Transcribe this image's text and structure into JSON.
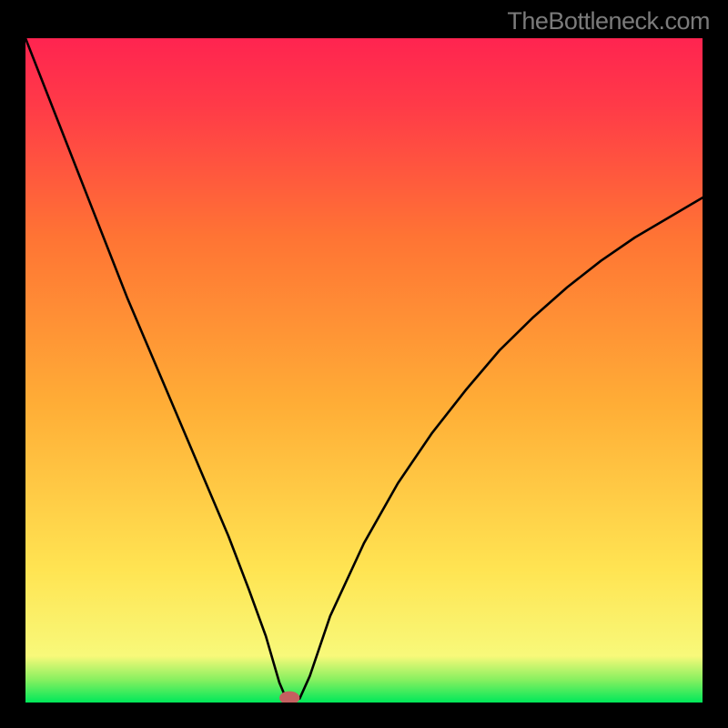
{
  "watermark": "TheBottleneck.com",
  "chart_data": {
    "type": "line",
    "title": "",
    "xlabel": "",
    "ylabel": "",
    "xlim": [
      0,
      100
    ],
    "ylim": [
      0,
      100
    ],
    "background_gradient": {
      "stops": [
        {
          "pos": 0.0,
          "color": "#00e85a"
        },
        {
          "pos": 0.035,
          "color": "#8af060"
        },
        {
          "pos": 0.07,
          "color": "#f8f97a"
        },
        {
          "pos": 0.2,
          "color": "#ffe452"
        },
        {
          "pos": 0.45,
          "color": "#ffad36"
        },
        {
          "pos": 0.7,
          "color": "#ff7434"
        },
        {
          "pos": 0.9,
          "color": "#ff3a48"
        },
        {
          "pos": 1.0,
          "color": "#ff2450"
        }
      ]
    },
    "marker": {
      "x": 39,
      "y": 0.7,
      "color": "#c46060",
      "rx": 1.5,
      "ry": 1.0
    },
    "series": [
      {
        "name": "bottleneck-curve",
        "x": [
          0,
          5,
          10,
          15,
          20,
          25,
          30,
          33,
          35.5,
          37.5,
          38.5,
          40.5,
          42,
          45,
          50,
          55,
          60,
          65,
          70,
          75,
          80,
          85,
          90,
          95,
          100
        ],
        "y": [
          100,
          87,
          74,
          61,
          49,
          37,
          25,
          17,
          10,
          3,
          0.6,
          0.6,
          4,
          13,
          24,
          33,
          40.5,
          47,
          53,
          58,
          62.5,
          66.5,
          70,
          73,
          76
        ]
      }
    ]
  }
}
